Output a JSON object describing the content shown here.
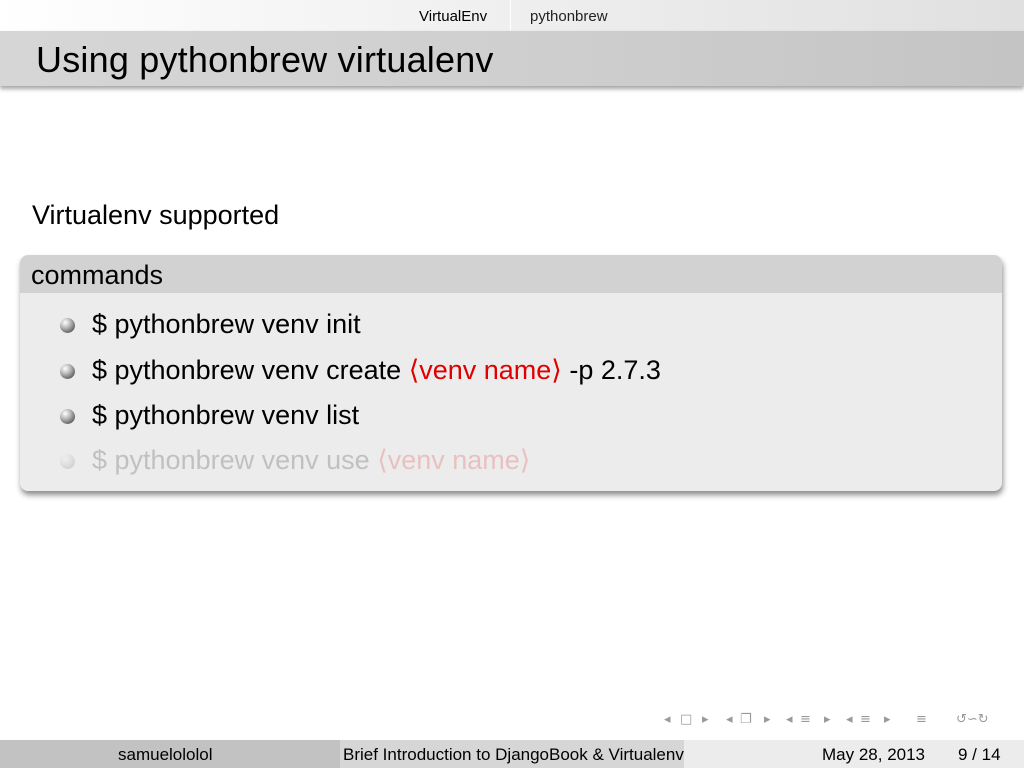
{
  "header": {
    "sections": [
      "VirtualEnv",
      "pythonbrew"
    ],
    "frame_title": "Using pythonbrew virtualenv"
  },
  "body": {
    "intro": "Virtualenv supported",
    "block": {
      "title": "commands",
      "items": [
        {
          "prefix": "$ pythonbrew venv init",
          "arg": "",
          "suffix": "",
          "faded": false
        },
        {
          "prefix": "$ pythonbrew venv create ",
          "arg": "⟨venv name⟩",
          "suffix": " -p 2.7.3",
          "faded": false
        },
        {
          "prefix": "$ pythonbrew venv list",
          "arg": "",
          "suffix": "",
          "faded": false
        },
        {
          "prefix": "$ pythonbrew venv use ",
          "arg": "⟨venv name⟩",
          "suffix": "",
          "faded": true
        }
      ]
    }
  },
  "nav_icons": [
    "nav-prev-arrow",
    "frame-icon",
    "nav-next-arrow",
    "subsection-icon",
    "section-icon",
    "document-icon",
    "search-icon"
  ],
  "footer": {
    "author": "samuelololol",
    "title": "Brief Introduction to DjangoBook & Virtualenv",
    "date": "May 28, 2013",
    "page": "9 / 14"
  },
  "colors": {
    "accent_red": "#e00000",
    "block_body": "#ececec",
    "block_title": "#d2d2d2",
    "frame_title": "#cfcfcf"
  }
}
